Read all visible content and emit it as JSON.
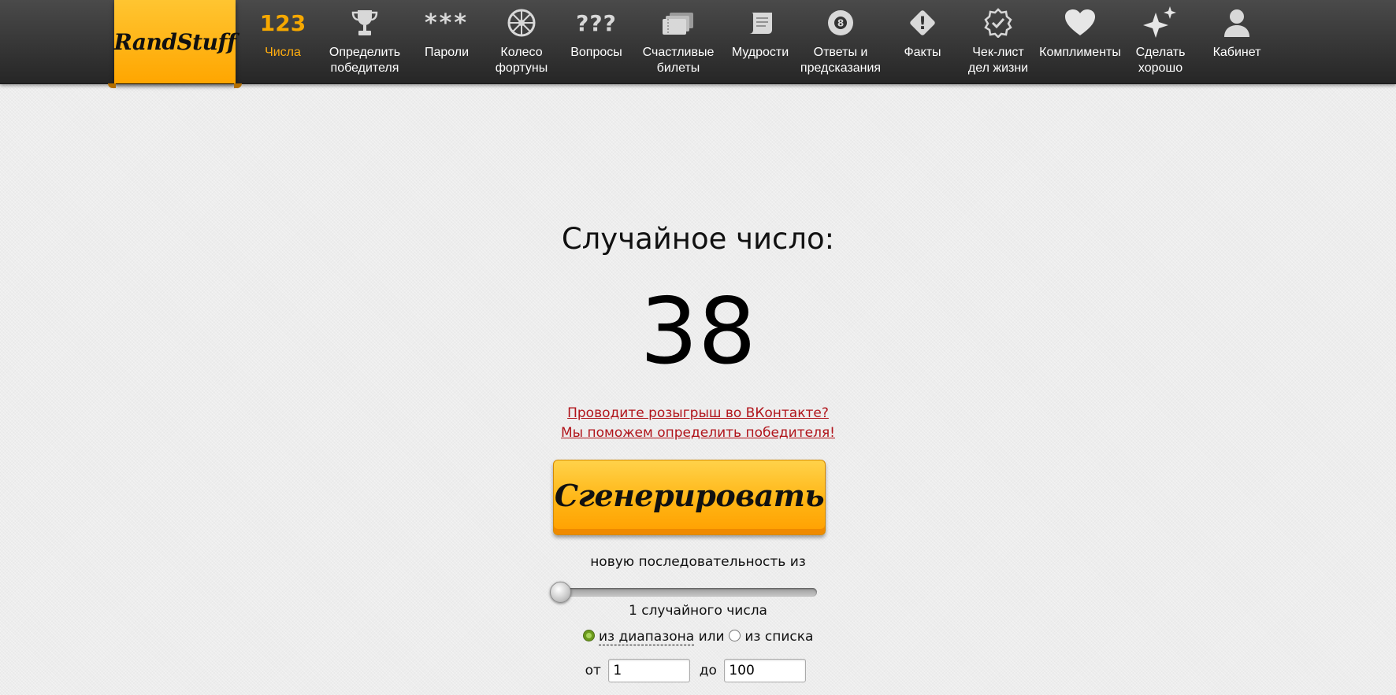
{
  "logo": {
    "text": "RandStuff"
  },
  "nav": {
    "items": [
      {
        "label": "Числа",
        "icon": "numbers-123-icon",
        "icon_text": "123",
        "active": true
      },
      {
        "label": "Определить\nпобедителя",
        "icon": "trophy-icon"
      },
      {
        "label": "Пароли",
        "icon": "password-asterisks-icon",
        "icon_text": "***"
      },
      {
        "label": "Колесо\nфортуны",
        "icon": "wheel-of-fortune-icon"
      },
      {
        "label": "Вопросы",
        "icon": "question-marks-icon",
        "icon_text": "???"
      },
      {
        "label": "Счастливые\nбилеты",
        "icon": "tickets-icon"
      },
      {
        "label": "Мудрости",
        "icon": "scroll-icon"
      },
      {
        "label": "Ответы и\nпредсказания",
        "icon": "magic-8-ball-icon",
        "icon_text": "8"
      },
      {
        "label": "Факты",
        "icon": "exclamation-diamond-icon",
        "icon_text": "!"
      },
      {
        "label": "Чек-лист\nдел жизни",
        "icon": "check-badge-icon"
      },
      {
        "label": "Комплименты",
        "icon": "heart-icon"
      },
      {
        "label": "Сделать\nхорошо",
        "icon": "sparkles-icon"
      },
      {
        "label": "Кабинет",
        "icon": "user-icon"
      }
    ]
  },
  "main": {
    "title": "Случайное число:",
    "result": "38",
    "promo_line1": "Проводите розыгрыш во ВКонтакте?",
    "promo_line2": "Мы поможем определить победителя!",
    "generate_label": "Сгенерировать",
    "sequence_label": "новую последовательность из",
    "count_label": "1 случайного числа",
    "count_slider_fraction": 0,
    "mode": {
      "range_label": "из диапазона",
      "or_label": "или",
      "list_label": "из списка",
      "selected": "range"
    },
    "range": {
      "from_label": "от",
      "from_value": "1",
      "to_label": "до",
      "to_value": "100"
    }
  },
  "colors": {
    "accent": "#ffad0f",
    "button": "#ffb514",
    "link": "#b1141b",
    "topbar": "#333333"
  }
}
